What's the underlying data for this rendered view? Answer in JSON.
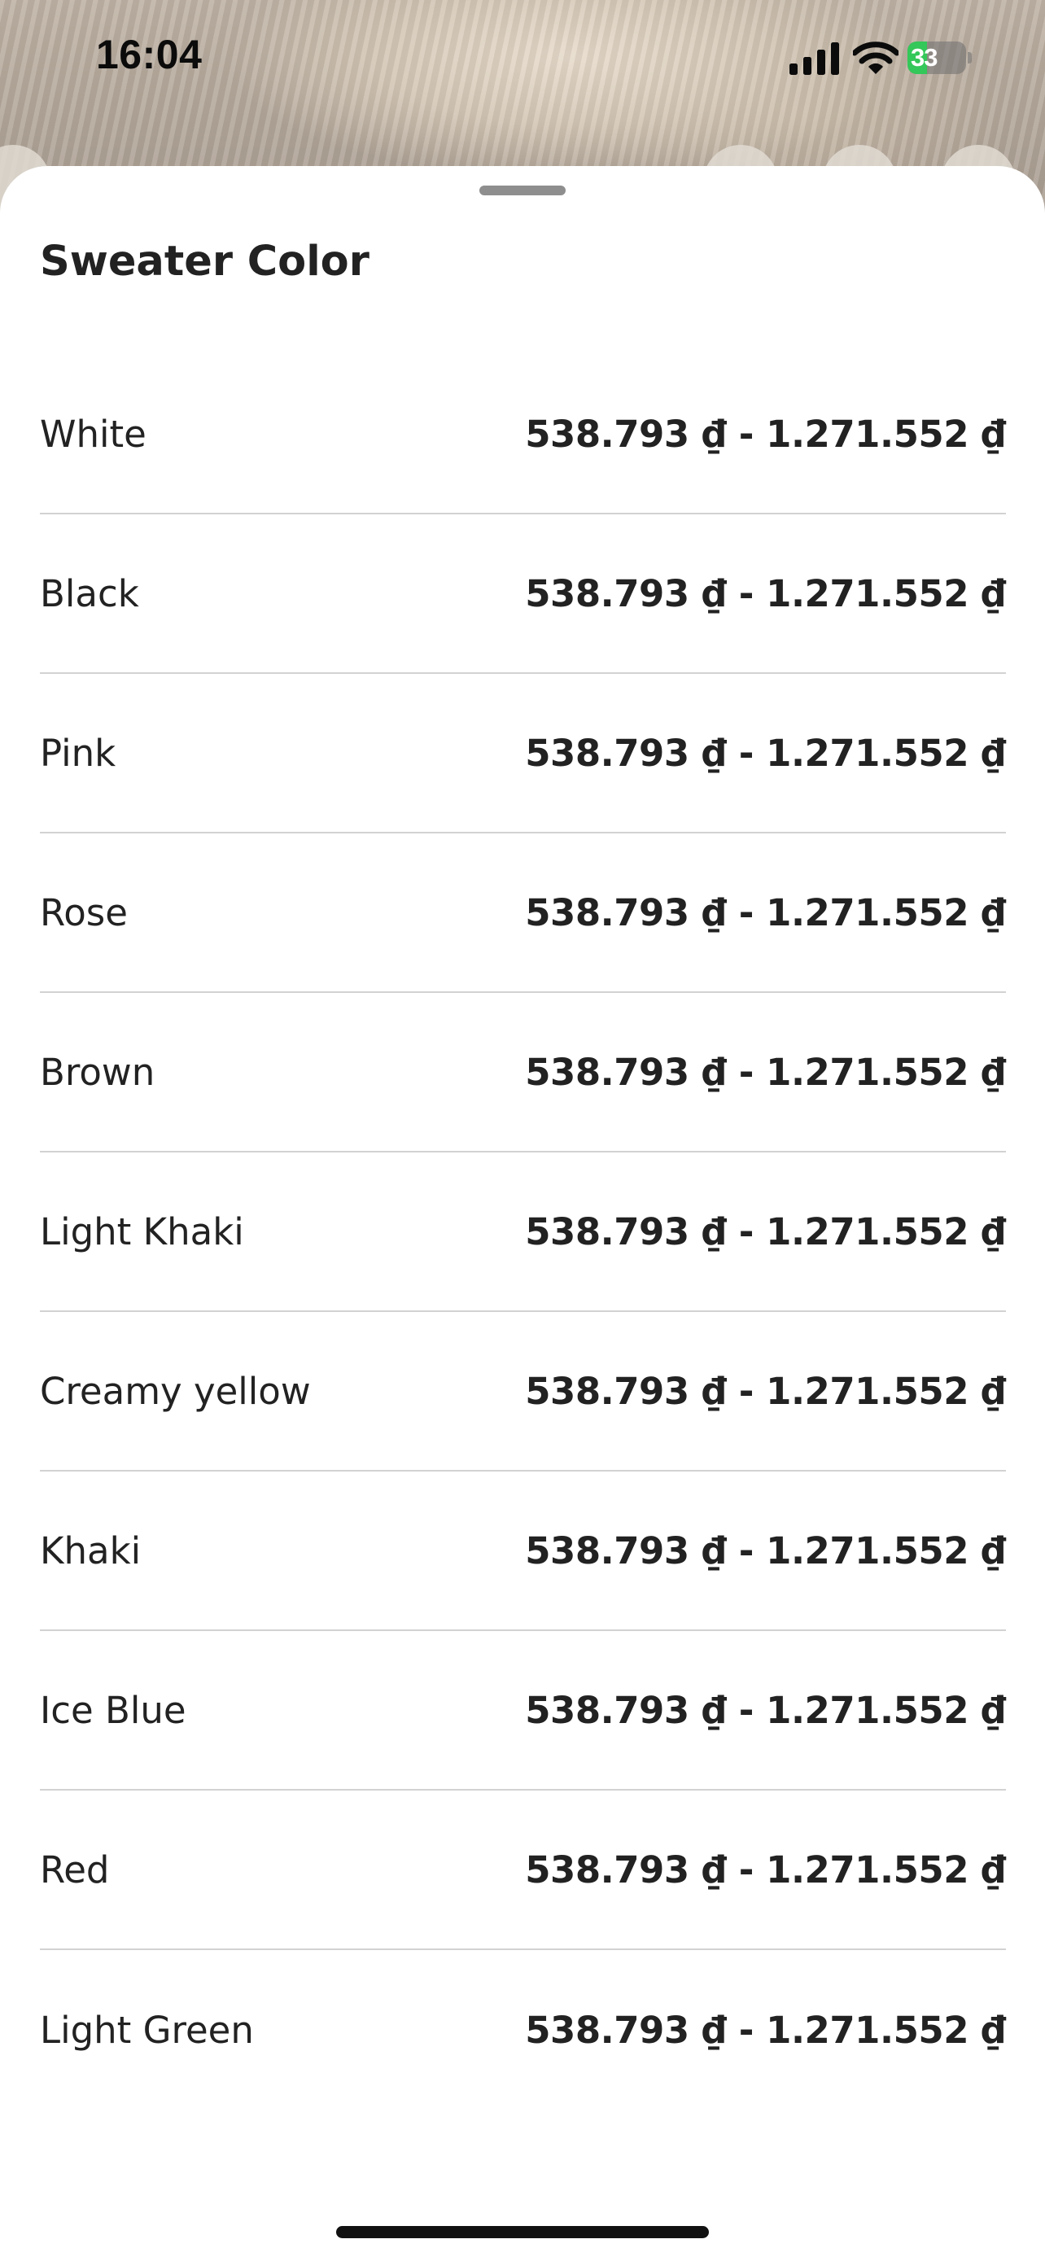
{
  "status_bar": {
    "time": "16:04",
    "battery_level": "33",
    "battery_charging": true,
    "battery_color": "#34c759",
    "icons": [
      "signal-icon",
      "wifi-icon",
      "battery-icon"
    ]
  },
  "sheet": {
    "title": "Sweater Color",
    "options": [
      {
        "name": "White",
        "price": "538.793 ₫ - 1.271.552 ₫"
      },
      {
        "name": "Black",
        "price": "538.793 ₫ - 1.271.552 ₫"
      },
      {
        "name": "Pink",
        "price": "538.793 ₫ - 1.271.552 ₫"
      },
      {
        "name": "Rose",
        "price": "538.793 ₫ - 1.271.552 ₫"
      },
      {
        "name": "Brown",
        "price": "538.793 ₫ - 1.271.552 ₫"
      },
      {
        "name": "Light Khaki",
        "price": "538.793 ₫ - 1.271.552 ₫"
      },
      {
        "name": "Creamy yellow",
        "price": "538.793 ₫ - 1.271.552 ₫"
      },
      {
        "name": "Khaki",
        "price": "538.793 ₫ - 1.271.552 ₫"
      },
      {
        "name": "Ice Blue",
        "price": "538.793 ₫ - 1.271.552 ₫"
      },
      {
        "name": "Red",
        "price": "538.793 ₫ - 1.271.552 ₫"
      },
      {
        "name": "Light Green",
        "price": "538.793 ₫ - 1.271.552 ₫"
      }
    ]
  },
  "colors": {
    "text": "#222222",
    "divider": "#d2d2d2",
    "sheet_background": "#ffffff"
  }
}
